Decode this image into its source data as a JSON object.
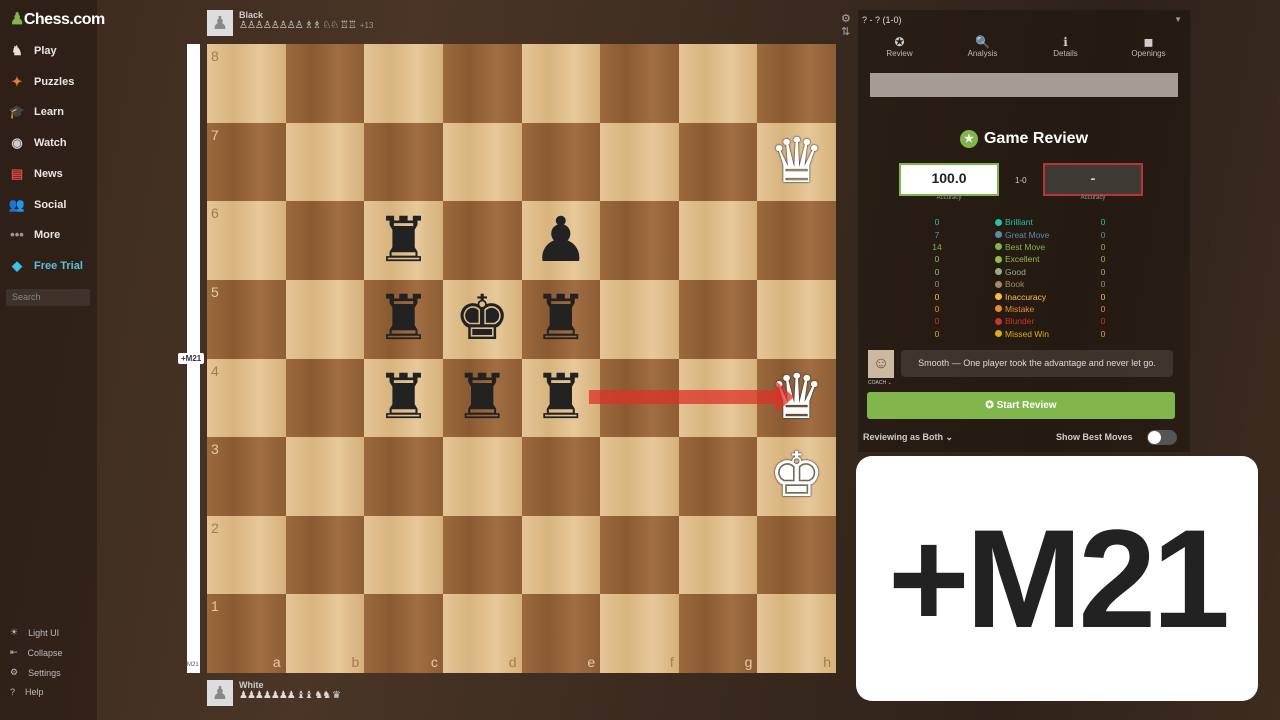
{
  "brand": {
    "logo": "Chess.com"
  },
  "sidebar": {
    "items": [
      {
        "label": "Play",
        "icon": "play-icon",
        "glyph": "♞",
        "color": "#e8e0d0"
      },
      {
        "label": "Puzzles",
        "icon": "puzzle-icon",
        "glyph": "✦",
        "color": "#e87a3c"
      },
      {
        "label": "Learn",
        "icon": "learn-icon",
        "glyph": "🎓",
        "color": "#3a9ad9"
      },
      {
        "label": "Watch",
        "icon": "binoculars-icon",
        "glyph": "◉",
        "color": "#ccc"
      },
      {
        "label": "News",
        "icon": "news-icon",
        "glyph": "▤",
        "color": "#d44"
      },
      {
        "label": "Social",
        "icon": "social-icon",
        "glyph": "👥",
        "color": "#c96"
      },
      {
        "label": "More",
        "icon": "more-icon",
        "glyph": "•••",
        "color": "#999"
      },
      {
        "label": "Free Trial",
        "icon": "diamond-icon",
        "glyph": "◆",
        "color": "#3cc4e8"
      }
    ],
    "search_placeholder": "Search",
    "bottom": [
      {
        "label": "Light UI",
        "glyph": "☀"
      },
      {
        "label": "Collapse",
        "glyph": "⇤"
      },
      {
        "label": "Settings",
        "glyph": "⚙"
      },
      {
        "label": "Help",
        "glyph": "?"
      }
    ]
  },
  "eval": {
    "tag": "+M21",
    "bottom": "M21"
  },
  "players": {
    "black": {
      "name": "Black",
      "captured": "♙♙♙♙♙♙♙♙ ♗♗ ♘♘ ♖♖",
      "diff": "+13"
    },
    "white": {
      "name": "White",
      "captured": "♟♟♟♟♟♟♟ ♝♝ ♞♞ ♛"
    }
  },
  "board": {
    "files": [
      "a",
      "b",
      "c",
      "d",
      "e",
      "f",
      "g",
      "h"
    ],
    "ranks": [
      "8",
      "7",
      "6",
      "5",
      "4",
      "3",
      "2",
      "1"
    ],
    "pieces": [
      {
        "sq": "h7",
        "p": "♛",
        "c": "w"
      },
      {
        "sq": "c6",
        "p": "♜",
        "c": "b"
      },
      {
        "sq": "e6",
        "p": "♟",
        "c": "b"
      },
      {
        "sq": "c5",
        "p": "♜",
        "c": "b"
      },
      {
        "sq": "d5",
        "p": "♚",
        "c": "b"
      },
      {
        "sq": "e5",
        "p": "♜",
        "c": "b"
      },
      {
        "sq": "c4",
        "p": "♜",
        "c": "b"
      },
      {
        "sq": "d4",
        "p": "♜",
        "c": "b"
      },
      {
        "sq": "e4",
        "p": "♜",
        "c": "b"
      },
      {
        "sq": "h4",
        "p": "♛",
        "c": "w"
      },
      {
        "sq": "h3",
        "p": "♚",
        "c": "w"
      }
    ],
    "arrow": {
      "from": "e4",
      "to": "h4",
      "color": "#dc3228"
    }
  },
  "panel": {
    "title": "? - ? (1-0)",
    "tabs": [
      {
        "label": "Review",
        "glyph": "✪"
      },
      {
        "label": "Analysis",
        "glyph": "🔍"
      },
      {
        "label": "Details",
        "glyph": "ℹ"
      },
      {
        "label": "Openings",
        "glyph": "◼"
      }
    ],
    "review_title": "Game Review",
    "white_accuracy": "100.0",
    "black_accuracy": "-",
    "accuracy_label": "Accuracy",
    "result": "1-0",
    "stats": [
      {
        "label": "Brilliant",
        "w": "0",
        "b": "0",
        "color": "#26c2a3"
      },
      {
        "label": "Great Move",
        "w": "7",
        "b": "0",
        "color": "#5c8bb0"
      },
      {
        "label": "Best Move",
        "w": "14",
        "b": "0",
        "color": "#81b64c"
      },
      {
        "label": "Excellent",
        "w": "0",
        "b": "0",
        "color": "#96bc4b"
      },
      {
        "label": "Good",
        "w": "0",
        "b": "0",
        "color": "#95af8a"
      },
      {
        "label": "Book",
        "w": "0",
        "b": "0",
        "color": "#a88865"
      },
      {
        "label": "Inaccuracy",
        "w": "0",
        "b": "0",
        "color": "#f7c045"
      },
      {
        "label": "Mistake",
        "w": "0",
        "b": "0",
        "color": "#e58f2a"
      },
      {
        "label": "Blunder",
        "w": "0",
        "b": "0",
        "color": "#ca3431"
      },
      {
        "label": "Missed Win",
        "w": "0",
        "b": "0",
        "color": "#dbac16"
      }
    ],
    "coach_label": "COACH ⌄",
    "coach_message": "Smooth — One player took the advantage and never let go.",
    "start_review": "Start Review",
    "reviewing_as": "Reviewing as Both ⌄",
    "show_best_moves": "Show Best Moves",
    "show_best_moves_on": false
  },
  "overlay": {
    "text": "+M21"
  }
}
